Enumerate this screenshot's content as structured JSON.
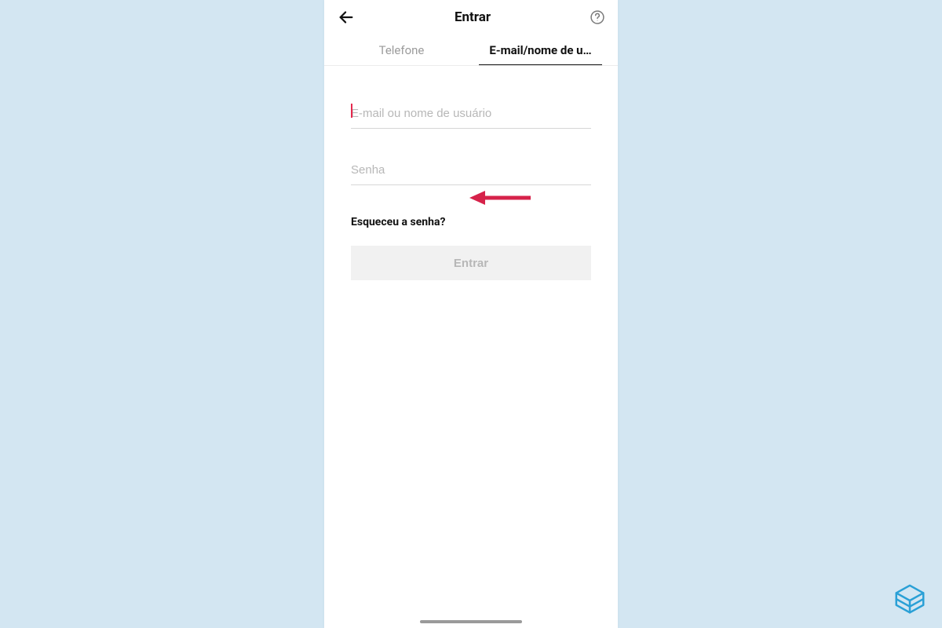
{
  "header": {
    "title": "Entrar"
  },
  "tabs": {
    "phone": "Telefone",
    "email": "E-mail/nome de u…"
  },
  "form": {
    "email_placeholder": "E-mail ou nome de usuário",
    "email_value": "",
    "password_placeholder": "Senha",
    "password_value": "",
    "forgot_label": "Esqueceu a senha?",
    "login_label": "Entrar"
  }
}
